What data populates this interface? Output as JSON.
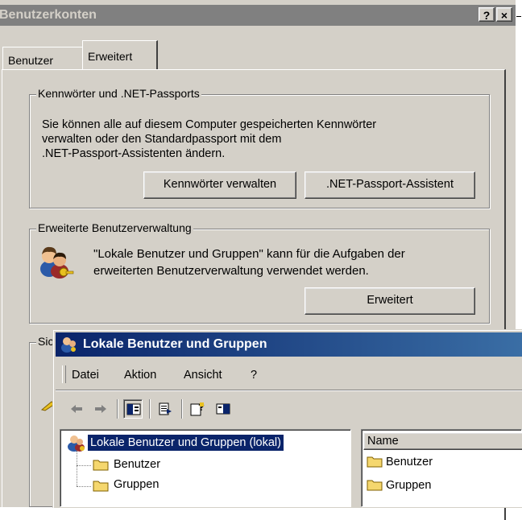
{
  "dialog": {
    "title": "Benutzerkonten",
    "help_button": "?",
    "close_button": "×",
    "tabs": [
      {
        "label": "Benutzer",
        "selected": false
      },
      {
        "label": "Erweitert",
        "selected": true
      }
    ],
    "passwords_group": {
      "legend": "Kennwörter und .NET-Passports",
      "text_lines": [
        "Sie können alle auf diesem Computer gespeicherten Kennwörter",
        "verwalten oder den Standardpassport mit dem",
        ".NET-Passport-Assistenten ändern."
      ],
      "manage_button": "Kennwörter verwalten",
      "wizard_button": ".NET-Passport-Assistent"
    },
    "advanced_group": {
      "legend": "Erweiterte Benutzerverwaltung",
      "text_lines": [
        "\"Lokale Benutzer und Gruppen\" kann für die Aufgaben der",
        "erweiterten Benutzerverwaltung verwendet werden."
      ],
      "advanced_button": "Erweitert"
    },
    "security_group": {
      "legend_visible": "Sic"
    }
  },
  "mmc": {
    "title": "Lokale Benutzer und Gruppen",
    "menu": [
      "Datei",
      "Aktion",
      "Ansicht",
      "?"
    ],
    "toolbar_icons": [
      "back-arrow-icon",
      "forward-arrow-icon",
      "show-hide-tree-icon",
      "export-list-icon",
      "help-icon",
      "properties-pane-icon"
    ],
    "tree": {
      "root": "Lokale Benutzer und Gruppen (lokal)",
      "children": [
        "Benutzer",
        "Gruppen"
      ]
    },
    "list": {
      "column_header": "Name",
      "items": [
        "Benutzer",
        "Gruppen"
      ]
    }
  },
  "colors": {
    "face": "#d4d0c8",
    "inactive_title": "#808080",
    "active_title_start": "#0a246a",
    "active_title_end": "#3a6ea5",
    "selection": "#0a246a",
    "folder": "#f5d76e"
  }
}
